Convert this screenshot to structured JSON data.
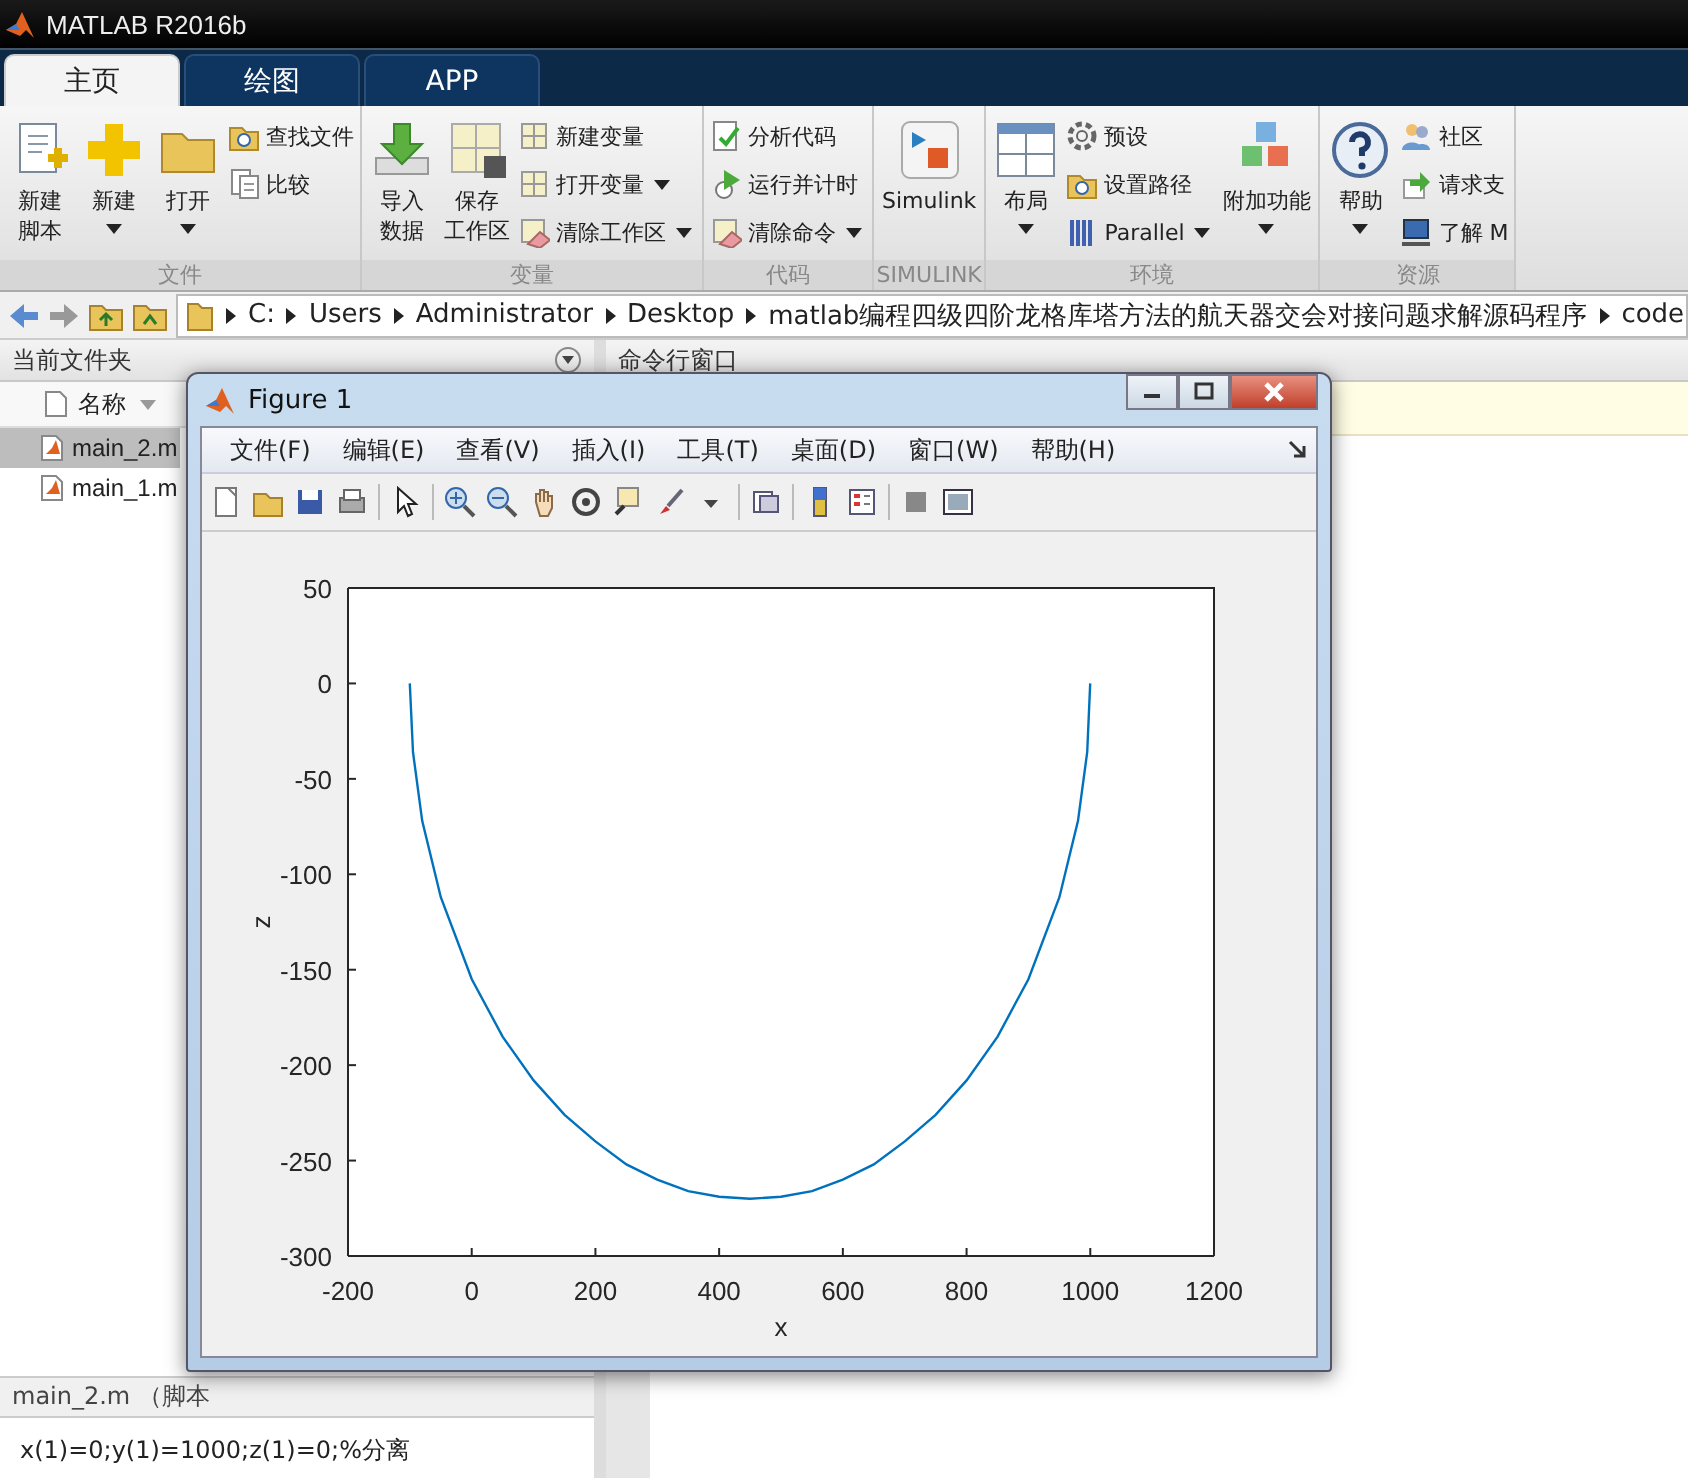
{
  "window": {
    "title": "MATLAB R2016b"
  },
  "tabs": [
    {
      "label": "主页",
      "selected": true
    },
    {
      "label": "绘图",
      "selected": false
    },
    {
      "label": "APP",
      "selected": false
    }
  ],
  "ribbon": [
    {
      "label": "文件",
      "items": [
        {
          "kind": "large",
          "lines": [
            "新建",
            "脚本"
          ]
        },
        {
          "kind": "large",
          "lines": [
            "新建"
          ],
          "dropdown": true
        },
        {
          "kind": "large",
          "lines": [
            "打开"
          ],
          "dropdown": true
        },
        {
          "kind": "stack",
          "items": [
            {
              "label": "查找文件"
            },
            {
              "label": "比较"
            }
          ]
        }
      ]
    },
    {
      "label": "变量",
      "items": [
        {
          "kind": "large",
          "lines": [
            "导入",
            "数据"
          ]
        },
        {
          "kind": "large",
          "lines": [
            "保存",
            "工作区"
          ]
        },
        {
          "kind": "stack",
          "items": [
            {
              "label": "新建变量"
            },
            {
              "label": "打开变量",
              "dropdown": true
            },
            {
              "label": "清除工作区",
              "dropdown": true
            }
          ]
        }
      ]
    },
    {
      "label": "代码",
      "items": [
        {
          "kind": "stack",
          "items": [
            {
              "label": "分析代码"
            },
            {
              "label": "运行并计时"
            },
            {
              "label": "清除命令",
              "dropdown": true
            }
          ]
        }
      ]
    },
    {
      "label": "SIMULINK",
      "items": [
        {
          "kind": "large",
          "lines": [
            "Simulink"
          ]
        }
      ]
    },
    {
      "label": "环境",
      "items": [
        {
          "kind": "large",
          "lines": [
            "布局"
          ],
          "dropdown": true
        },
        {
          "kind": "stack",
          "items": [
            {
              "label": "预设"
            },
            {
              "label": "设置路径"
            },
            {
              "label": "Parallel",
              "dropdown": true
            }
          ]
        },
        {
          "kind": "large",
          "lines": [
            "附加功能"
          ],
          "dropdown": true
        }
      ]
    },
    {
      "label": "资源",
      "items": [
        {
          "kind": "large",
          "lines": [
            "帮助"
          ],
          "dropdown": true
        },
        {
          "kind": "stack",
          "items": [
            {
              "label": "社区"
            },
            {
              "label": "请求支"
            },
            {
              "label": "了解 M"
            }
          ]
        }
      ]
    }
  ],
  "address": [
    "C:",
    "Users",
    "Administrator",
    "Desktop",
    "matlab编程四级四阶龙格库塔方法的航天器交会对接问题求解源码程序",
    "code"
  ],
  "current_folder": {
    "title": "当前文件夹",
    "column": "名称",
    "files": [
      {
        "name": "main_2.m",
        "selected": true
      },
      {
        "name": "main_1.m",
        "selected": false
      }
    ],
    "details": "main_2.m （脚本",
    "preview": "x(1)=0;y(1)=1000;z(1)=0;%分离"
  },
  "command_window": {
    "title": "命令行窗口"
  },
  "figure": {
    "title": "Figure 1",
    "menu": [
      "文件(F)",
      "编辑(E)",
      "查看(V)",
      "插入(I)",
      "工具(T)",
      "桌面(D)",
      "窗口(W)",
      "帮助(H)"
    ],
    "chart_data": {
      "type": "line",
      "xlabel": "x",
      "ylabel": "z",
      "xlim": [
        -200,
        1200
      ],
      "ylim": [
        -300,
        50
      ],
      "xticks": [
        -200,
        0,
        200,
        400,
        600,
        800,
        1000,
        1200
      ],
      "yticks": [
        -300,
        -250,
        -200,
        -150,
        -100,
        -50,
        0,
        50
      ],
      "series": [
        {
          "color": "#0072bd",
          "x": [
            -100,
            -95,
            -80,
            -50,
            0,
            50,
            100,
            150,
            200,
            250,
            300,
            350,
            400,
            450,
            500,
            550,
            600,
            650,
            700,
            750,
            800,
            850,
            900,
            950,
            980,
            995,
            1000
          ],
          "values": [
            0,
            -36,
            -72,
            -112,
            -155,
            -185,
            -208,
            -226,
            -240,
            -252,
            -260,
            -266,
            -269,
            -270,
            -269,
            -266,
            -260,
            -252,
            -240,
            -226,
            -208,
            -185,
            -155,
            -112,
            -72,
            -36,
            0
          ]
        }
      ]
    }
  }
}
